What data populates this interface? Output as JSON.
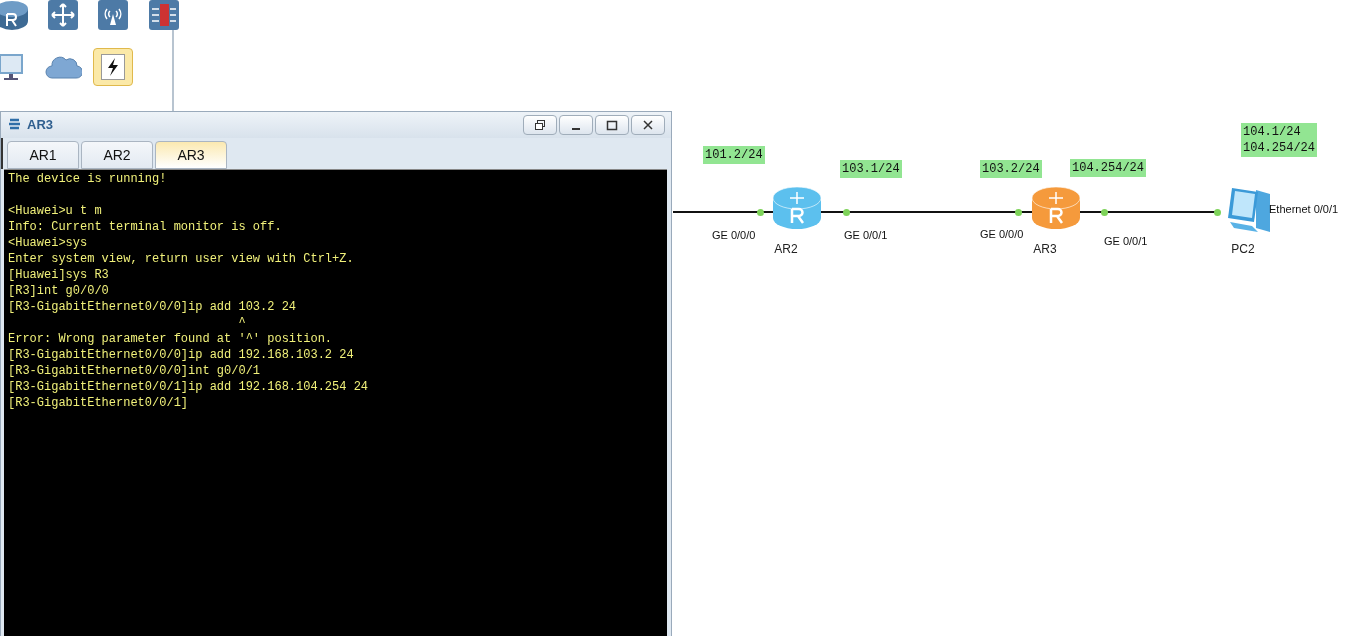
{
  "palette": {
    "items": [
      {
        "kind": "router",
        "selected": false
      },
      {
        "kind": "switch",
        "selected": false
      },
      {
        "kind": "wireless",
        "selected": false
      },
      {
        "kind": "firewall",
        "selected": false
      },
      {
        "kind": "pc",
        "selected": false
      },
      {
        "kind": "cloud",
        "selected": false
      },
      {
        "kind": "link",
        "selected": true
      }
    ]
  },
  "terminal": {
    "title": "AR3",
    "tabs": [
      {
        "label": "AR1",
        "selected": false
      },
      {
        "label": "AR2",
        "selected": false
      },
      {
        "label": "AR3",
        "selected": true
      }
    ],
    "blocks": [
      [
        "The device is running!"
      ],
      [
        "<Huawei>u t m",
        "Info: Current terminal monitor is off.",
        "<Huawei>sys",
        "Enter system view, return user view with Ctrl+Z.",
        "[Huawei]sys R3",
        "[R3]int g0/0/0",
        "[R3-GigabitEthernet0/0/0]ip add 103.2 24",
        "                                ^",
        "Error: Wrong parameter found at '^' position.",
        "[R3-GigabitEthernet0/0/0]ip add 192.168.103.2 24",
        "[R3-GigabitEthernet0/0/0]int g0/0/1",
        "[R3-GigabitEthernet0/0/1]ip add 192.168.104.254 24",
        "[R3-GigabitEthernet0/0/1]"
      ]
    ]
  },
  "topology": {
    "nodes": [
      {
        "kind": "router",
        "name": "AR2",
        "color": "#5cc0ee"
      },
      {
        "kind": "router",
        "name": "AR3",
        "color": "#f59a3c"
      },
      {
        "kind": "pc",
        "name": "PC2"
      }
    ],
    "ports": [
      "GE 0/0/0",
      "GE 0/0/1",
      "GE 0/0/0",
      "GE 0/0/1",
      "Ethernet 0/0/1"
    ],
    "ip_labels": [
      {
        "lines": [
          "101.2/24"
        ]
      },
      {
        "lines": [
          "103.1/24"
        ]
      },
      {
        "lines": [
          "103.2/24"
        ]
      },
      {
        "lines": [
          "104.254/24"
        ]
      },
      {
        "lines": [
          "104.1/24",
          "104.254/24"
        ]
      }
    ]
  }
}
